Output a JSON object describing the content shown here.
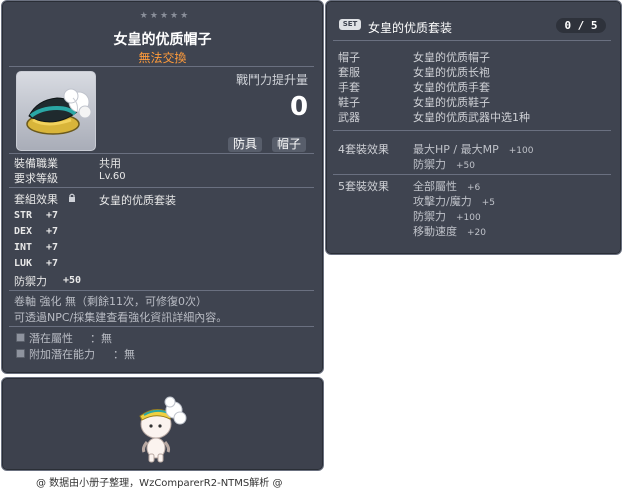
{
  "item_id": "01003159",
  "item": {
    "name": "女皇的优质帽子",
    "trade": "無法交換",
    "power_label": "戰鬥力提升量",
    "power_value": "0",
    "tags": [
      "防具",
      "帽子"
    ],
    "stars": 5
  },
  "requirements": {
    "job_label": "裝備職業",
    "job_value": "共用",
    "level_label": "要求等級",
    "level_value": "Lv.60"
  },
  "set_effect": {
    "label": "套組效果",
    "value": "女皇的优质套装"
  },
  "stats": [
    {
      "name": "STR",
      "value": "+7"
    },
    {
      "name": "DEX",
      "value": "+7"
    },
    {
      "name": "INT",
      "value": "+7"
    },
    {
      "name": "LUK",
      "value": "+7"
    },
    {
      "name": "防禦力",
      "value": "+50"
    }
  ],
  "upgrade": {
    "line1": "卷軸 強化 無（剩餘11次，可修復0次）",
    "line2": "可透過NPC/採集建查看強化資訊詳細內容。"
  },
  "potential": [
    {
      "label": "潛在屬性",
      "value": "：無"
    },
    {
      "label": "附加潛在能力",
      "value": "：無"
    }
  ],
  "set_panel": {
    "badge": "SET",
    "title": "女皇的优质套装",
    "count": "0 / 5",
    "parts": [
      {
        "slot": "帽子",
        "name": "女皇的优质帽子"
      },
      {
        "slot": "套服",
        "name": "女皇的优质长袍"
      },
      {
        "slot": "手套",
        "name": "女皇的优质手套"
      },
      {
        "slot": "鞋子",
        "name": "女皇的优质鞋子"
      },
      {
        "slot": "武器",
        "name": "女皇的优质武器中选1种"
      }
    ],
    "effects": [
      {
        "label": "4套裝效果",
        "lines": [
          {
            "text": "最大HP / 最大MP",
            "value": "+100"
          },
          {
            "text": "防禦力",
            "value": "+50"
          }
        ]
      },
      {
        "label": "5套裝效果",
        "lines": [
          {
            "text": "全部屬性",
            "value": "+6"
          },
          {
            "text": "攻擊力/魔力",
            "value": "+5"
          },
          {
            "text": "防禦力",
            "value": "+100"
          },
          {
            "text": "移動速度",
            "value": "+20"
          }
        ]
      }
    ]
  },
  "footer": "@ 数据由小册子整理，WzComparerR2-NTMS解析 @"
}
